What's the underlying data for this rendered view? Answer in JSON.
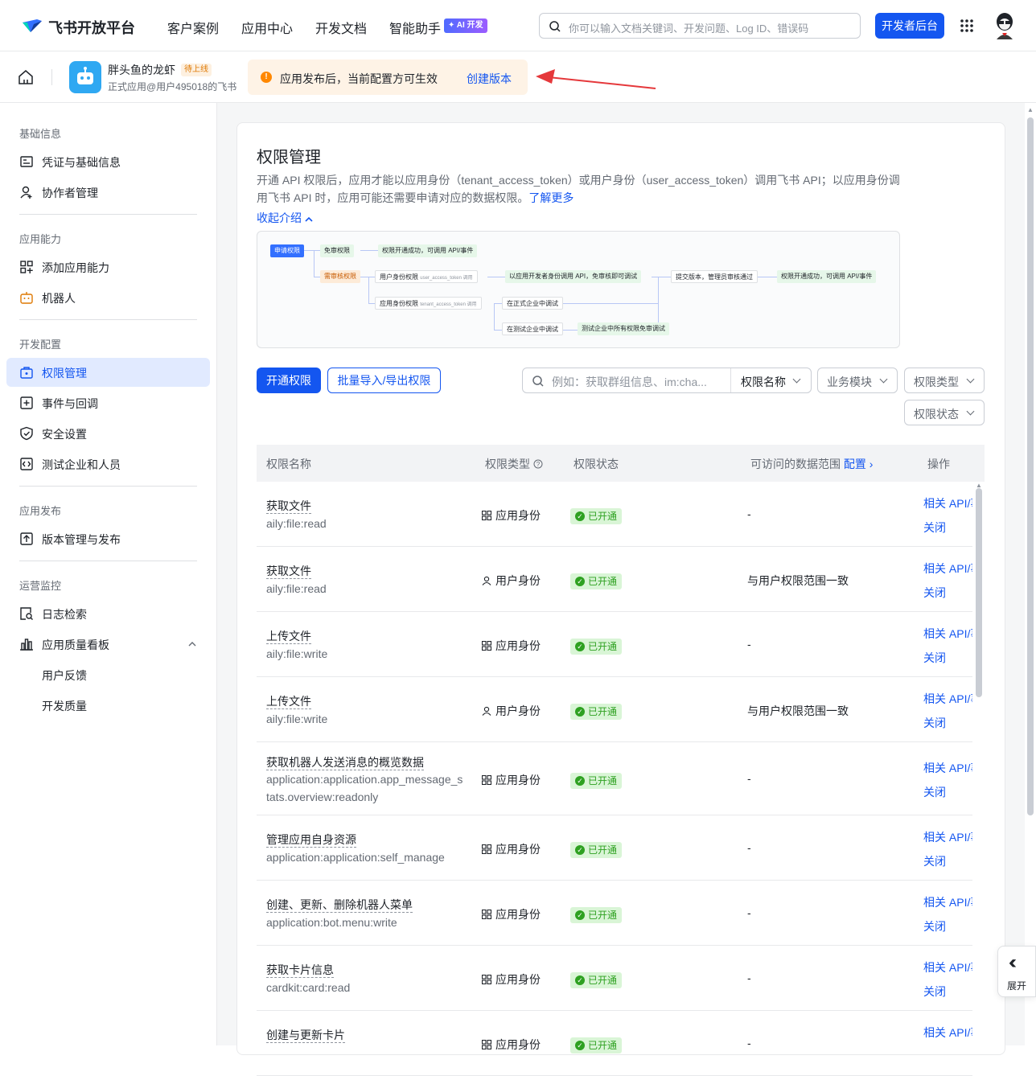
{
  "topnav": {
    "brand": "飞书开放平台",
    "links": [
      "客户案例",
      "应用中心",
      "开发文档",
      "智能助手"
    ],
    "ai_badge": "✦ AI 开发",
    "search_placeholder": "你可以输入文档关键词、开发问题、Log ID、错误码",
    "dev_button": "开发者后台"
  },
  "subheader": {
    "app_name": "胖头鱼的龙虾",
    "status_tag": "待上线",
    "app_sub": "正式应用@用户495018的飞书",
    "notice_text": "应用发布后，当前配置方可生效",
    "notice_link": "创建版本"
  },
  "sidebar": {
    "sections": [
      {
        "title": "基础信息",
        "items": [
          {
            "label": "凭证与基础信息",
            "icon": "credential-icon"
          },
          {
            "label": "协作者管理",
            "icon": "collaborator-icon"
          }
        ]
      },
      {
        "title": "应用能力",
        "items": [
          {
            "label": "添加应用能力",
            "icon": "add-capability-icon"
          },
          {
            "label": "机器人",
            "icon": "robot-icon"
          }
        ]
      },
      {
        "title": "开发配置",
        "items": [
          {
            "label": "权限管理",
            "icon": "permission-icon",
            "active": true
          },
          {
            "label": "事件与回调",
            "icon": "event-icon"
          },
          {
            "label": "安全设置",
            "icon": "shield-icon"
          },
          {
            "label": "测试企业和人员",
            "icon": "test-icon"
          }
        ]
      },
      {
        "title": "应用发布",
        "items": [
          {
            "label": "版本管理与发布",
            "icon": "upload-icon"
          }
        ]
      },
      {
        "title": "运营监控",
        "items": [
          {
            "label": "日志检索",
            "icon": "log-search-icon"
          },
          {
            "label": "应用质量看板",
            "icon": "chart-icon"
          },
          {
            "label": "用户反馈"
          },
          {
            "label": "开发质量"
          }
        ]
      }
    ]
  },
  "main": {
    "title": "权限管理",
    "intro": "开通 API 权限后，应用才能以应用身份（tenant_access_token）或用户身份（user_access_token）调用飞书 API；以应用身份调用飞书 API 时，应用可能还需要申请对应的数据权限。",
    "learn_more": "了解更多",
    "collapse": "收起介绍",
    "flow": {
      "apply": "申请权限",
      "no_review": "免审权限",
      "success1": "权限开通成功，可调用 API/事件",
      "need_review": "需审核权限",
      "user_perm": "用户身份权限",
      "user_token": "user_access_token 调用",
      "dev_call": "以应用开发者身份调用 API，免审核即可调试",
      "submit": "提交版本，管理员审核通过",
      "success2": "权限开通成功，可调用 API/事件",
      "app_perm": "应用身份权限",
      "tenant_token": "tenant_access_token 调用",
      "formal_debug": "在正式企业中调试",
      "test_debug": "在测试企业中调试",
      "test_all": "测试企业中所有权限免审调试"
    },
    "open_button": "开通权限",
    "batch_button": "批量导入/导出权限",
    "filter_placeholder": "例如：获取群组信息、im:cha...",
    "filter_field": "权限名称",
    "filters": [
      "业务模块",
      "权限类型",
      "权限状态"
    ],
    "columns": [
      "权限名称",
      "权限类型",
      "权限状态",
      "可访问的数据范围",
      "配置",
      "操作"
    ],
    "rows": [
      {
        "name": "获取文件",
        "scope": "aily:file:read",
        "type": "应用身份",
        "type_icon": "app-grid-icon",
        "status": "已开通",
        "range": "-",
        "op1": "相关 API/事件",
        "op2": "关闭"
      },
      {
        "name": "获取文件",
        "scope": "aily:file:read",
        "type": "用户身份",
        "type_icon": "user-icon",
        "status": "已开通",
        "range": "与用户权限范围一致",
        "op1": "相关 API/事件",
        "op2": "关闭"
      },
      {
        "name": "上传文件",
        "scope": "aily:file:write",
        "type": "应用身份",
        "type_icon": "app-grid-icon",
        "status": "已开通",
        "range": "-",
        "op1": "相关 API/事件",
        "op2": "关闭"
      },
      {
        "name": "上传文件",
        "scope": "aily:file:write",
        "type": "用户身份",
        "type_icon": "user-icon",
        "status": "已开通",
        "range": "与用户权限范围一致",
        "op1": "相关 API/事件",
        "op2": "关闭"
      },
      {
        "name": "获取机器人发送消息的概览数据",
        "scope": "application:application.app_message_stats.overview:readonly",
        "type": "应用身份",
        "type_icon": "app-grid-icon",
        "status": "已开通",
        "range": "-",
        "op1": "相关 API/事件",
        "op2": "关闭"
      },
      {
        "name": "管理应用自身资源",
        "scope": "application:application:self_manage",
        "type": "应用身份",
        "type_icon": "app-grid-icon",
        "status": "已开通",
        "range": "-",
        "op1": "相关 API/事件",
        "op2": "关闭"
      },
      {
        "name": "创建、更新、删除机器人菜单",
        "scope": "application:bot.menu:write",
        "type": "应用身份",
        "type_icon": "app-grid-icon",
        "status": "已开通",
        "range": "-",
        "op1": "相关 API/事件",
        "op2": "关闭"
      },
      {
        "name": "获取卡片信息",
        "scope": "cardkit:card:read",
        "type": "应用身份",
        "type_icon": "app-grid-icon",
        "status": "已开通",
        "range": "-",
        "op1": "相关 API/事件",
        "op2": "关闭"
      },
      {
        "name": "创建与更新卡片",
        "scope": "",
        "type": "应用身份",
        "type_icon": "app-grid-icon",
        "status": "已开通",
        "range": "-",
        "op1": "相关 API/事件",
        "op2": ""
      }
    ],
    "expand_label": "展开"
  }
}
